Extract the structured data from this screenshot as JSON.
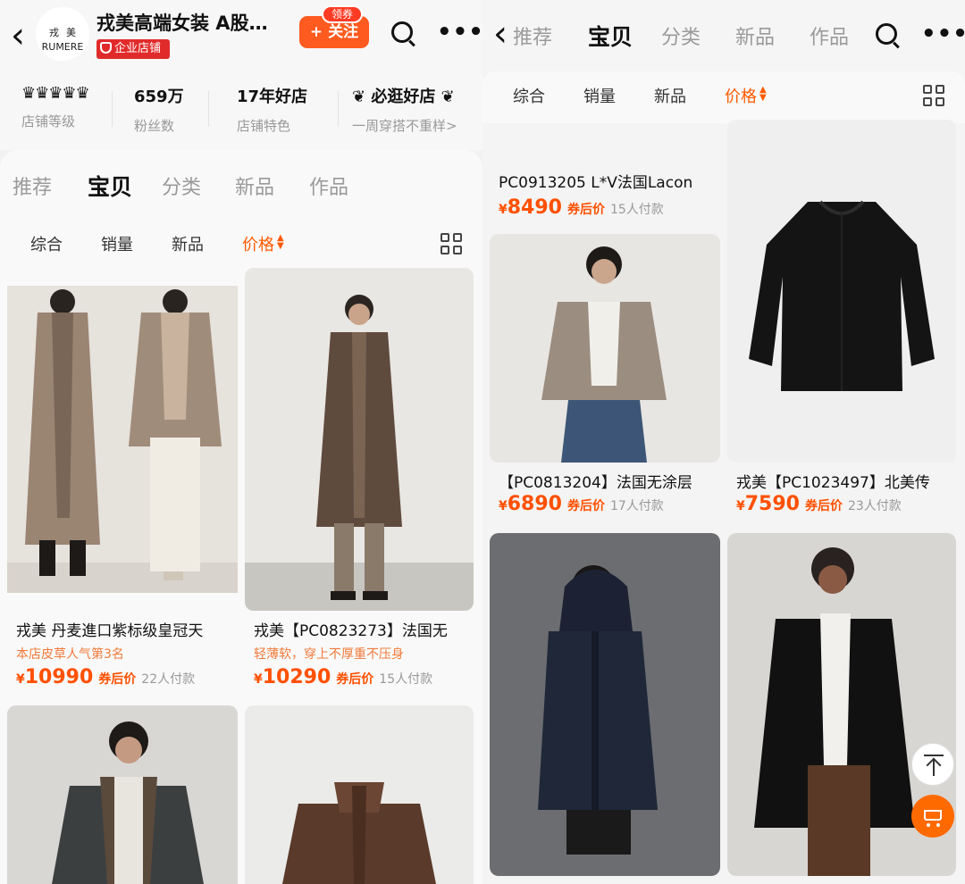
{
  "left": {
    "shop": {
      "logo_cn": "戎美",
      "logo_en": "RUMERE",
      "name": "戎美高端女装 A股…",
      "badge": "企业店铺",
      "follow": "+ 关注",
      "coupon": "领券"
    },
    "stats": [
      {
        "value": "♛♛♛♛♛",
        "label": "店铺等级"
      },
      {
        "value": "659万",
        "label": "粉丝数"
      },
      {
        "value": "17年好店",
        "label": "店铺特色"
      },
      {
        "value": "必逛好店",
        "label": "一周穿搭不重样>"
      }
    ],
    "tabs": [
      "推荐",
      "宝贝",
      "分类",
      "新品",
      "作品"
    ],
    "sorts": [
      "综合",
      "销量",
      "新品",
      "价格"
    ],
    "products": [
      {
        "title": "戎美 丹麦進口紫标级皇冠天",
        "sub": "本店皮草人气第3名",
        "yen": "¥",
        "price": "10990",
        "after": "券后价",
        "paid": "22人付款"
      },
      {
        "title": "戎美【PC0823273】法国无",
        "sub": "轻薄软，穿上不厚重不压身",
        "yen": "¥",
        "price": "10290",
        "after": "券后价",
        "paid": "15人付款"
      }
    ]
  },
  "right": {
    "tabs": [
      "推荐",
      "宝贝",
      "分类",
      "新品",
      "作品"
    ],
    "sorts": [
      "综合",
      "销量",
      "新品",
      "价格"
    ],
    "products": [
      {
        "title": "PC0913205 L*V法国Lacon",
        "yen": "¥",
        "price": "8490",
        "after": "券后价",
        "paid": "15人付款"
      },
      {
        "title": "【PC0813204】法国无涂层",
        "yen": "¥",
        "price": "6890",
        "after": "券后价",
        "paid": "17人付款"
      },
      {
        "title": "戎美【PC1023497】北美传",
        "yen": "¥",
        "price": "7590",
        "after": "券后价",
        "paid": "23人付款"
      }
    ]
  },
  "icons": {
    "back": "back-chevron-icon",
    "search": "search-icon",
    "more": "more-dots-icon",
    "layout": "grid-layout-icon",
    "top": "back-to-top-icon",
    "cart": "cart-icon"
  },
  "colors": {
    "accent": "#ff5000",
    "follow_button": "#ff5a1f",
    "enterprise_badge": "#e12b2b",
    "price": "#ff5000"
  }
}
